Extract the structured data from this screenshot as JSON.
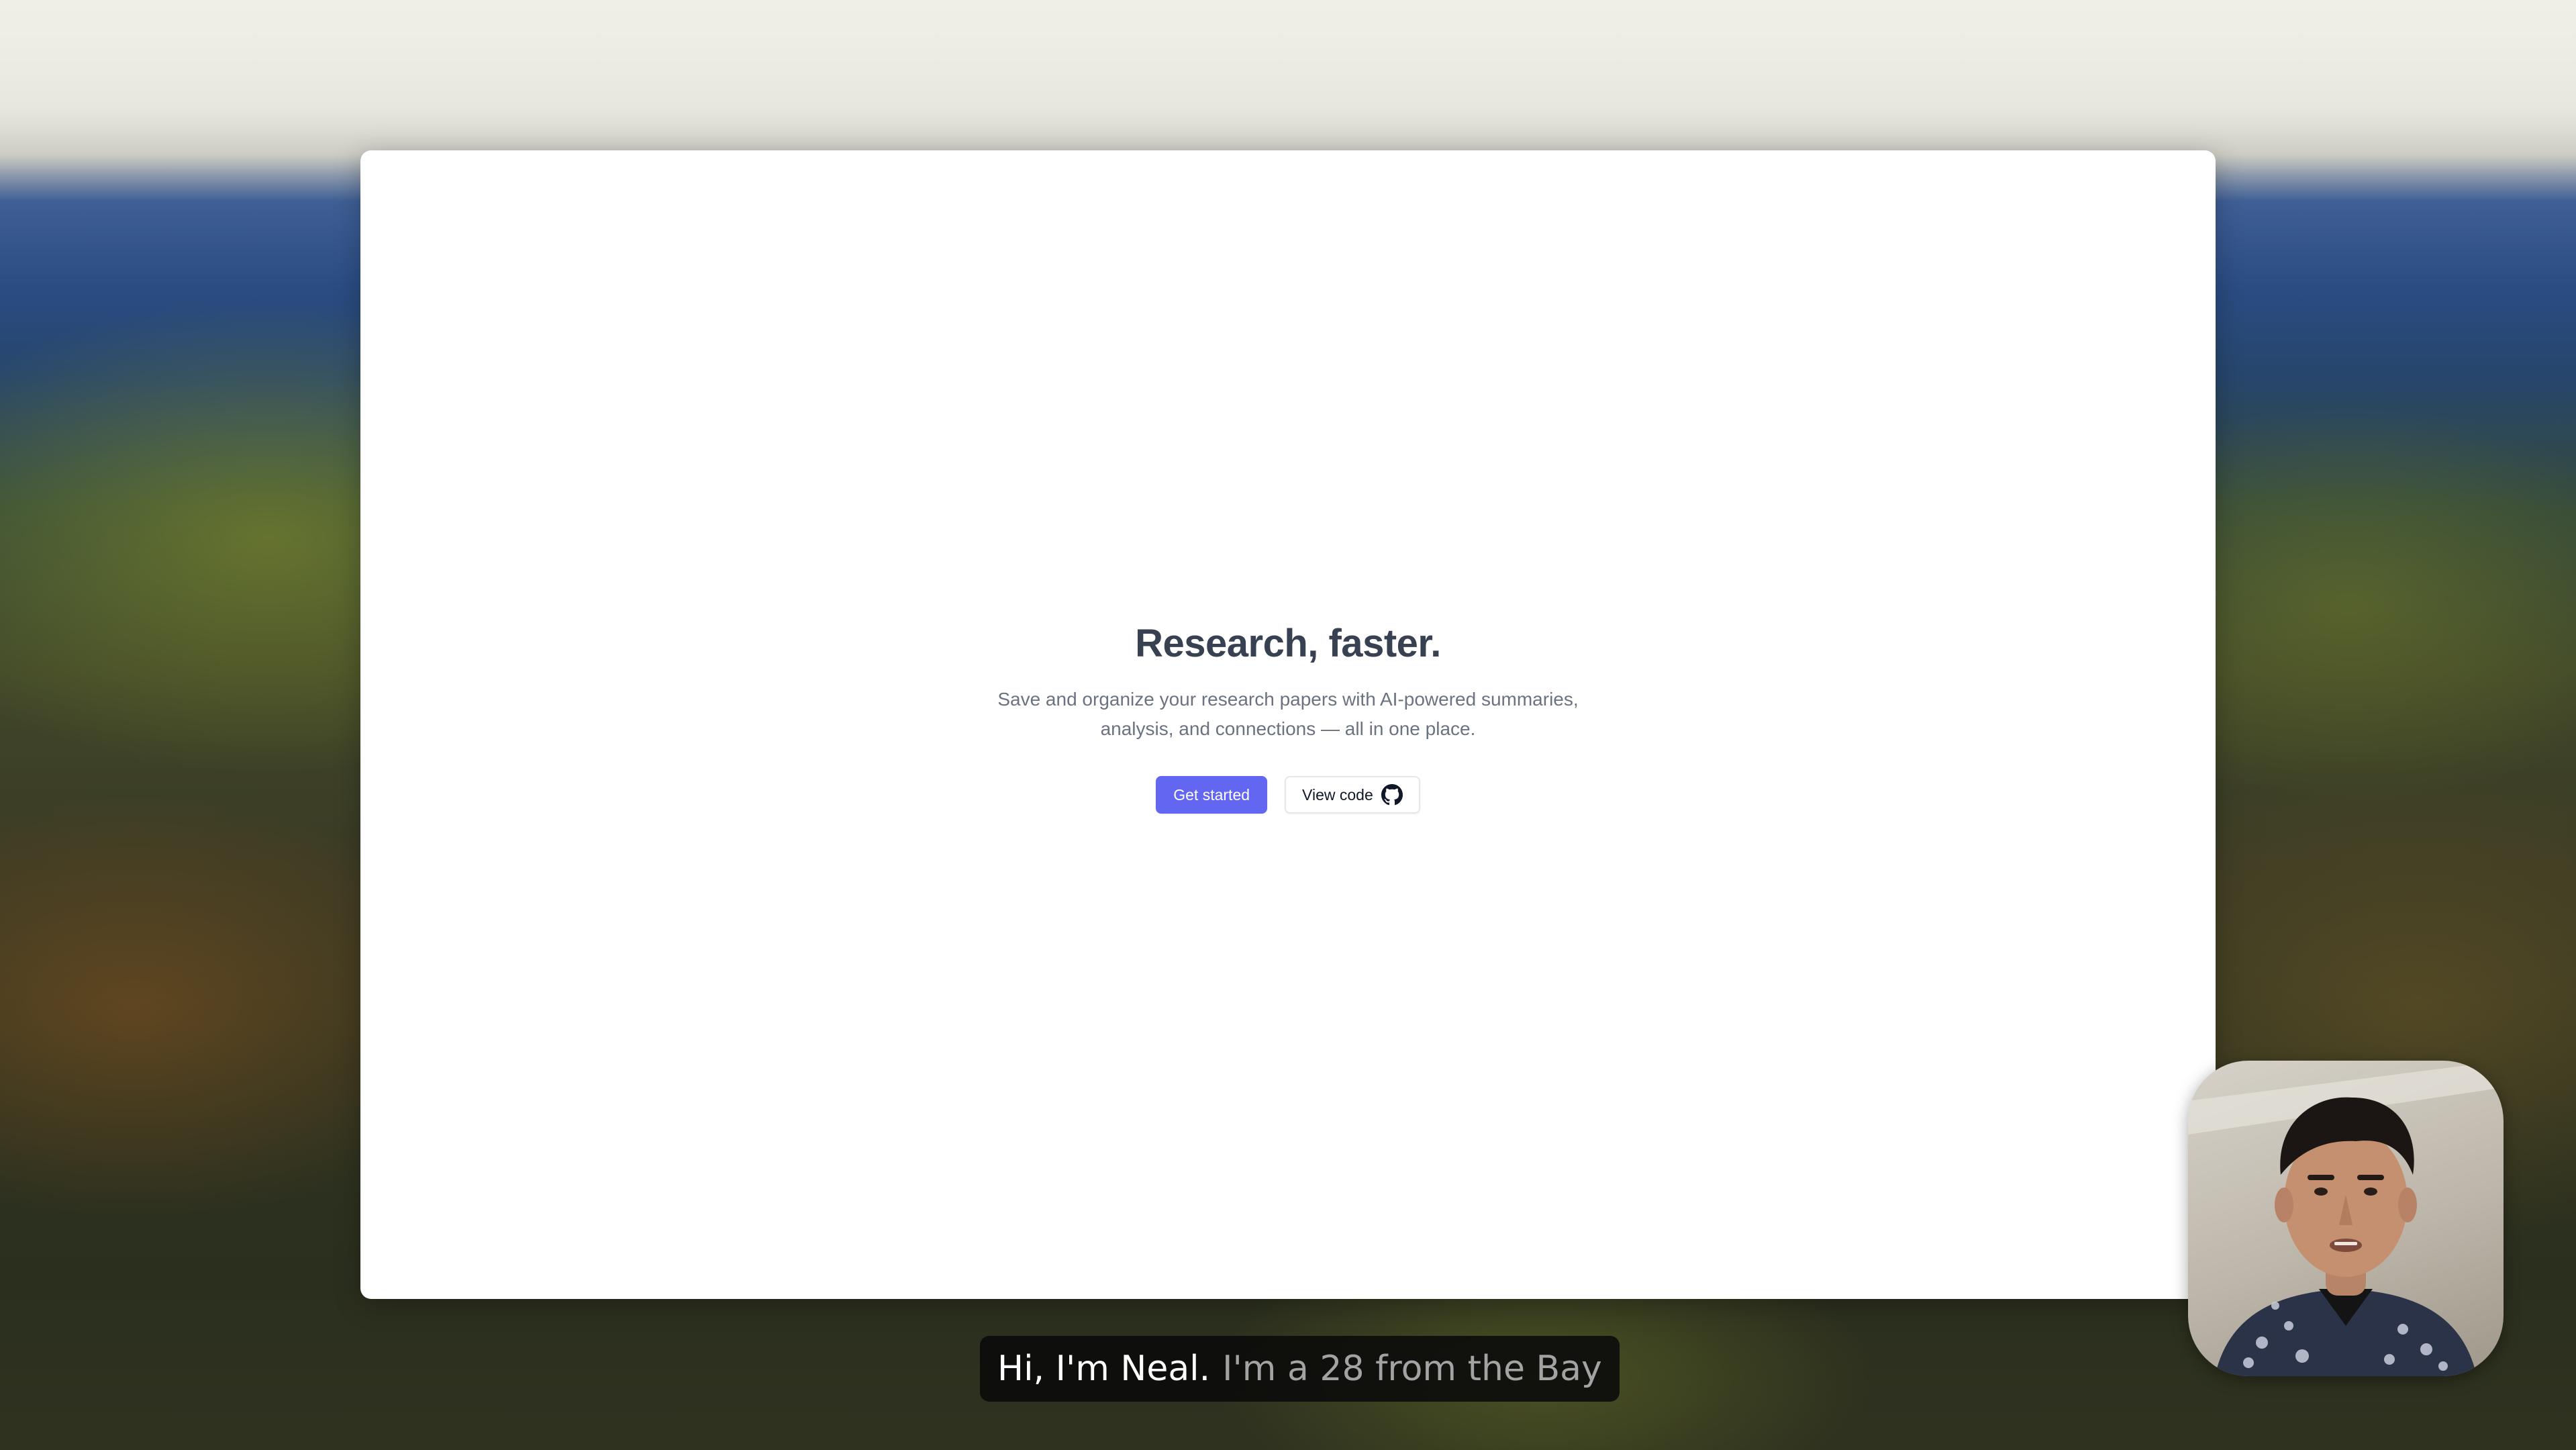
{
  "hero": {
    "title": "Research, faster.",
    "subtitle": "Save and organize your research papers with AI-powered summaries, analysis, and connections — all in one place.",
    "primary_button_label": "Get started",
    "secondary_button_label": "View code",
    "secondary_button_icon": "github-icon"
  },
  "caption": {
    "spoken": "Hi, I'm Neal.",
    "upcoming": "I'm a 28 from the Bay"
  },
  "colors": {
    "accent": "#6366f1",
    "title": "#374151",
    "subtitle": "#6b7280",
    "caption_bg": "#0a0a0a"
  }
}
